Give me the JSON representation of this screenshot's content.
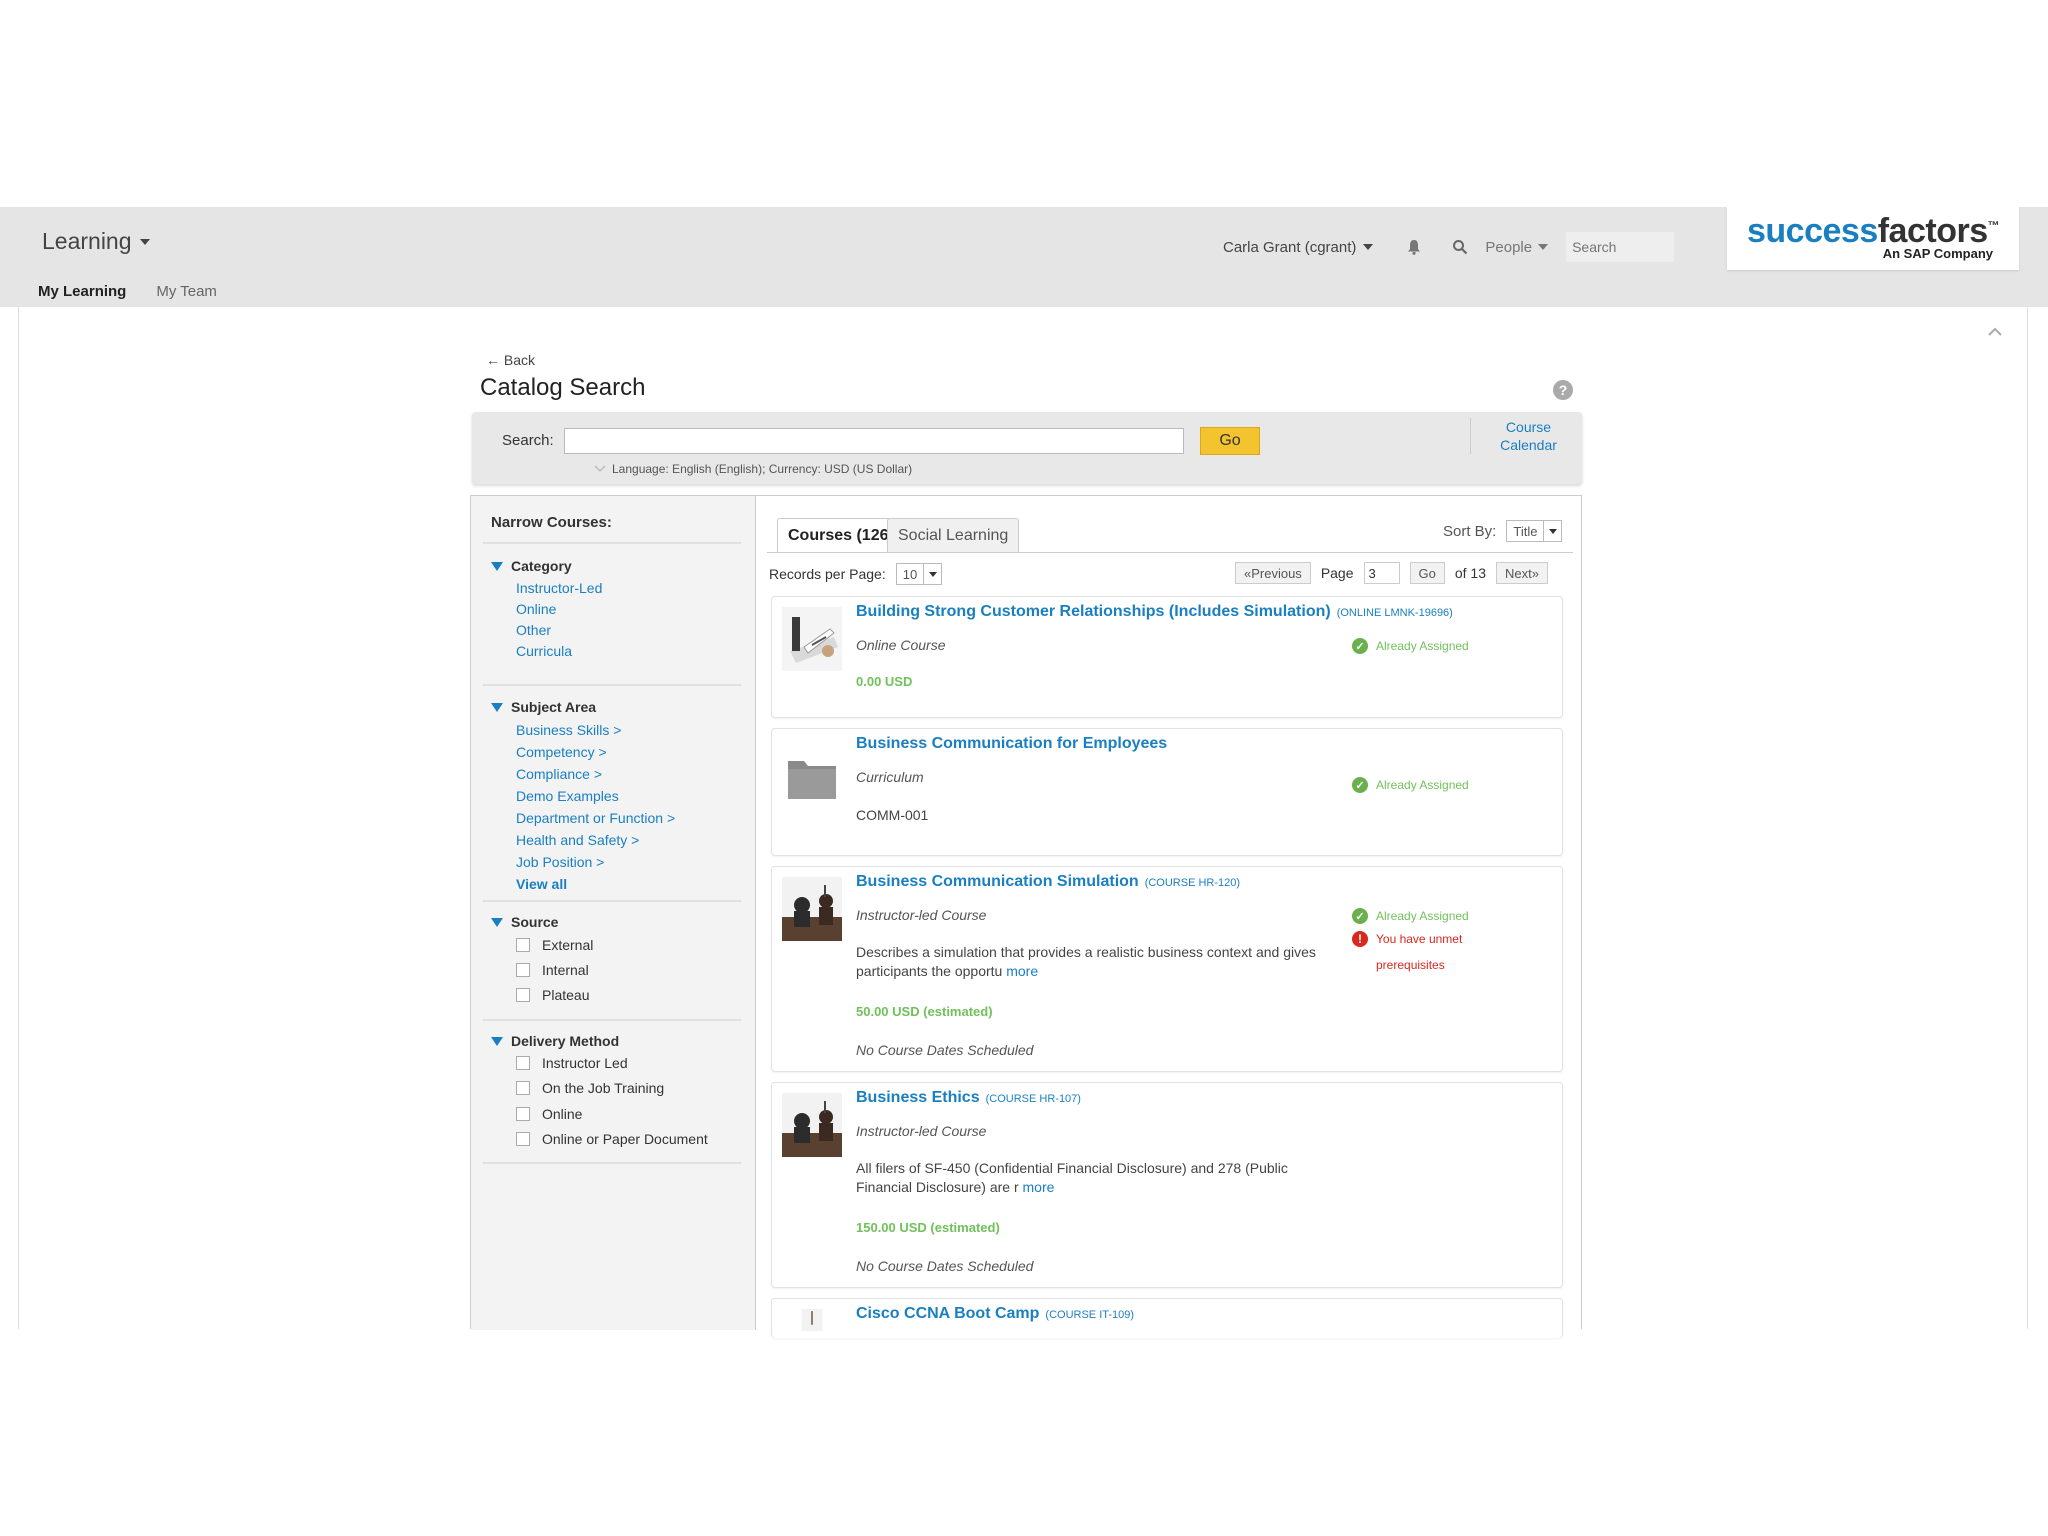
{
  "header": {
    "app_menu_label": "Learning",
    "subnav": [
      "My Learning",
      "My Team"
    ],
    "user": "Carla Grant (cgrant)",
    "people_label": "People",
    "search_placeholder": "Search",
    "logo": {
      "part1": "success",
      "part2": "factors",
      "tm": "™",
      "sub": "An SAP Company"
    }
  },
  "page": {
    "back_label": "← Back",
    "title": "Catalog Search",
    "help_glyph": "?"
  },
  "searchbar": {
    "label": "Search:",
    "value": "",
    "go_label": "Go",
    "language_line": "Language: English (English); Currency: USD (US Dollar)",
    "course_calendar": [
      "Course",
      "Calendar"
    ]
  },
  "sidebar": {
    "title": "Narrow Courses:",
    "category": {
      "label": "Category",
      "items": [
        "Instructor-Led",
        "Online",
        "Other",
        "Curricula"
      ]
    },
    "subject_area": {
      "label": "Subject Area",
      "items": [
        "Business Skills >",
        "Competency >",
        "Compliance >",
        "Demo Examples",
        "Department or Function >",
        "Health and Safety >",
        "Job Position >"
      ],
      "view_all": "View all"
    },
    "source": {
      "label": "Source",
      "items": [
        "External",
        "Internal",
        "Plateau"
      ]
    },
    "delivery": {
      "label": "Delivery Method",
      "items": [
        "Instructor Led",
        "On the Job Training",
        "Online",
        "Online or Paper Document"
      ]
    }
  },
  "results": {
    "tabs": [
      "Courses (126)",
      "Social Learning"
    ],
    "sort_label": "Sort By:",
    "sort_value": "Title",
    "rpp_label": "Records per Page:",
    "rpp_value": "10",
    "prev_label": "«Previous",
    "page_label": "Page",
    "page_value": "3",
    "go_label": "Go",
    "of_label": "of 13",
    "next_label": "Next»",
    "status_assigned": "Already Assigned",
    "status_prereq": "You have unmet prerequisites",
    "items": [
      {
        "title": "Building Strong Customer Relationships (Includes Simulation)",
        "code": "(ONLINE LMNK-19696)",
        "type": "Online Course",
        "price": "0.00 USD"
      },
      {
        "title": "Business Communication for Employees",
        "code": "",
        "type": "Curriculum",
        "id": "COMM-001"
      },
      {
        "title": "Business Communication Simulation",
        "code": "(COURSE HR-120)",
        "type": "Instructor-led Course",
        "desc": "Describes a simulation that provides a realistic business context and gives participants the opportu",
        "more": "more",
        "price": "50.00 USD (estimated)",
        "dates": "No Course Dates Scheduled"
      },
      {
        "title": "Business Ethics",
        "code": "(COURSE HR-107)",
        "type": "Instructor-led Course",
        "desc": "All filers of SF-450 (Confidential Financial Disclosure) and 278 (Public Financial Disclosure) are r",
        "more": "more",
        "price": "150.00 USD (estimated)",
        "dates": "No Course Dates Scheduled"
      },
      {
        "title": "Cisco CCNA Boot Camp",
        "code": "(COURSE IT-109)"
      }
    ]
  }
}
